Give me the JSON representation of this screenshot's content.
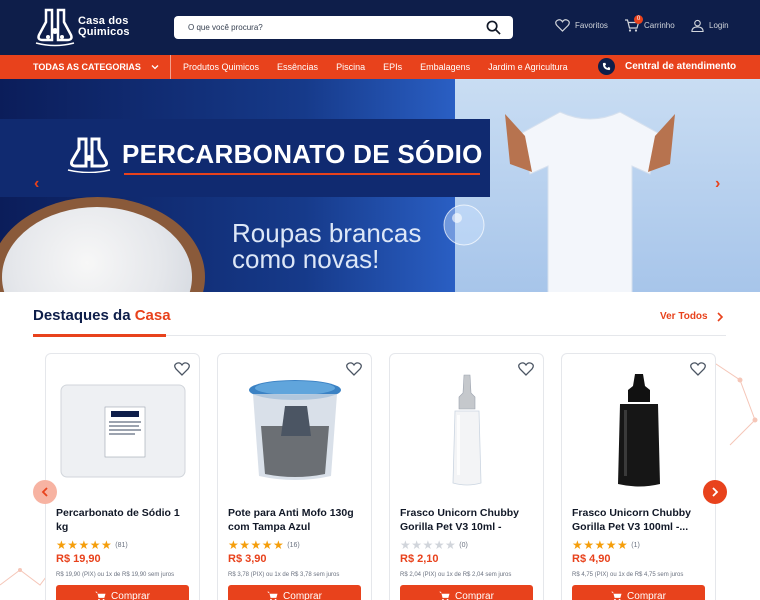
{
  "header": {
    "logo_line1": "Casa dos",
    "logo_line2": "Quimicos",
    "search_placeholder": "O que você procura?",
    "favorites_label": "Favoritos",
    "cart_label": "Carrinho",
    "cart_count": "0",
    "login_label": "Login"
  },
  "nav": {
    "all_categories": "TODAS AS CATEGORIAS",
    "items": [
      "Produtos Quimicos",
      "Essências",
      "Piscina",
      "EPIs",
      "Embalagens",
      "Jardim e Agricultura"
    ],
    "support_label": "Central de atendimento"
  },
  "banner": {
    "title": "PERCARBONATO DE SÓDIO",
    "subtitle_line1": "Roupas brancas",
    "subtitle_line2": "como novas!"
  },
  "section": {
    "title_main": "Destaques da ",
    "title_accent": "Casa",
    "see_all": "Ver Todos"
  },
  "products": [
    {
      "name": "Percarbonato de Sódio 1 kg",
      "stars": "★★★★★",
      "rating_count": "(81)",
      "price": "R$ 19,90",
      "pix_text": "R$ 19,90 (PIX) ou 1x de R$ 19,90 sem juros",
      "buy_label": "Comprar"
    },
    {
      "name": "Pote para Anti Mofo 130g com Tampa Azul",
      "stars": "★★★★★",
      "rating_count": "(16)",
      "price": "R$ 3,90",
      "pix_text": "R$ 3,78 (PIX) ou 1x de R$ 3,78 sem juros",
      "buy_label": "Comprar"
    },
    {
      "name": "Frasco Unicorn Chubby Gorilla Pet V3 10ml - Frasc...",
      "stars": "★★★★★",
      "rating_count": "(0)",
      "price": "R$ 2,10",
      "pix_text": "R$ 2,04 (PIX) ou 1x de R$ 2,04 sem juros",
      "buy_label": "Comprar"
    },
    {
      "name": "Frasco Unicorn Chubby Gorilla Pet V3 100ml -...",
      "stars": "★★★★★",
      "rating_count": "(1)",
      "price": "R$ 4,90",
      "pix_text": "R$ 4,75 (PIX) ou 1x de R$ 4,75 sem juros",
      "buy_label": "Comprar"
    }
  ],
  "colors": {
    "navy": "#0e1e4a",
    "accent": "#e8421c",
    "star_filled": "#f59e0b",
    "star_empty": "#d1d5db"
  }
}
